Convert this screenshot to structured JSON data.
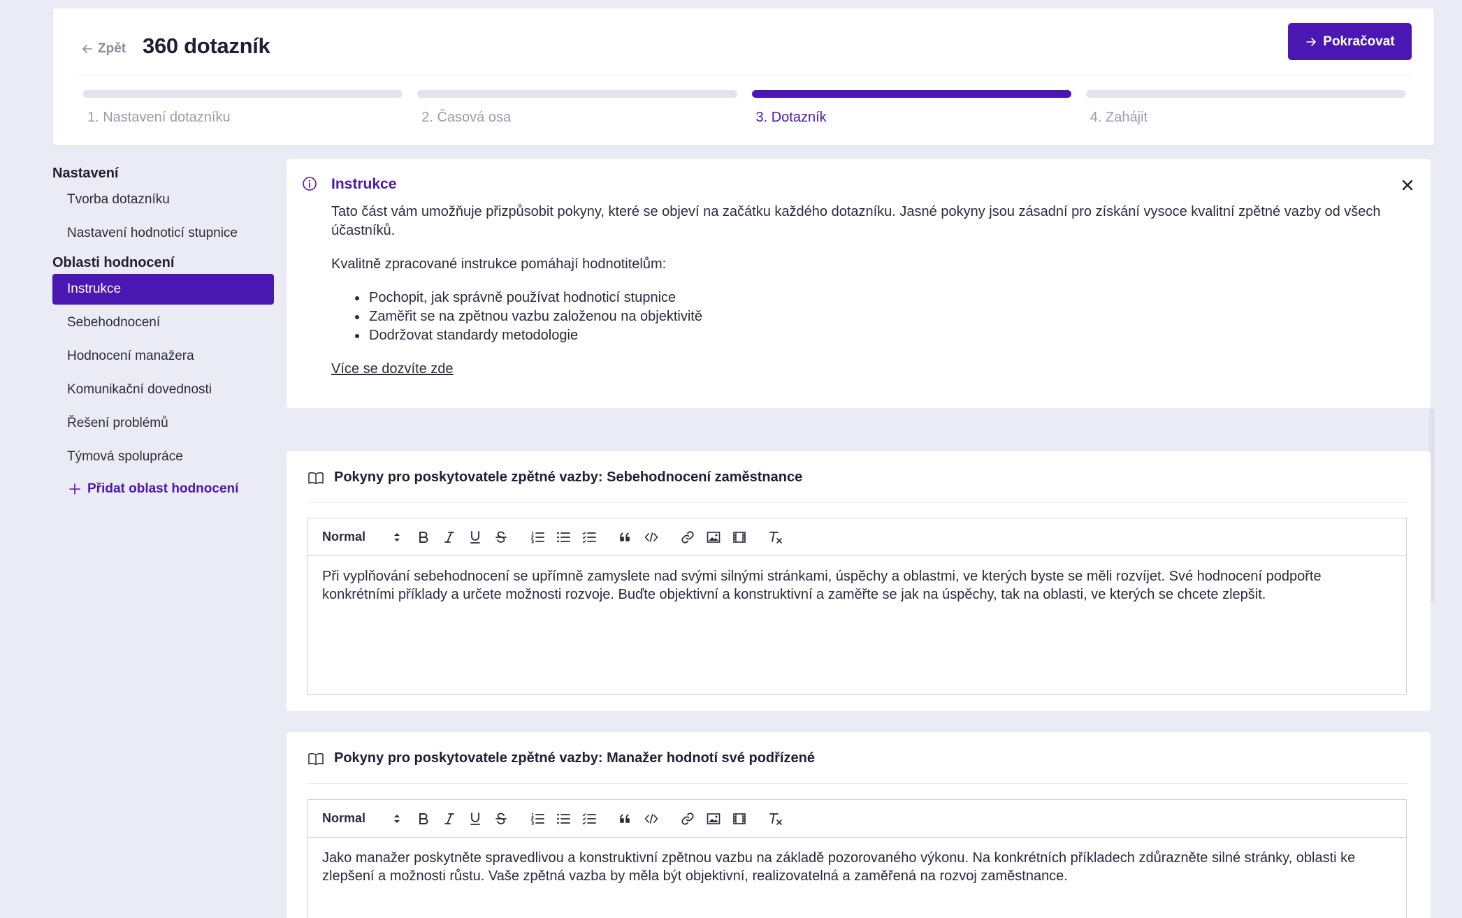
{
  "header": {
    "back_label": "Zpět",
    "title": "360 dotazník",
    "continue_label": "Pokračovat"
  },
  "stepper": [
    {
      "label": "1. Nastavení dotazníku",
      "active": false
    },
    {
      "label": "2. Časová osa",
      "active": false
    },
    {
      "label": "3. Dotazník",
      "active": true
    },
    {
      "label": "4. Zahájit",
      "active": false
    }
  ],
  "sidebar": {
    "settings_heading": "Nastavení",
    "settings_items": [
      "Tvorba dotazníku",
      "Nastavení hodnoticí stupnice"
    ],
    "areas_heading": "Oblasti hodnocení",
    "area_items": [
      "Instrukce",
      "Sebehodnocení",
      "Hodnocení manažera",
      "Komunikační dovednosti",
      "Řešení problémů",
      "Týmová spolupráce"
    ],
    "active_item": "Instrukce",
    "add_label": "Přidat oblast hodnocení"
  },
  "info": {
    "title": "Instrukce",
    "paragraph1": "Tato část vám umožňuje přizpůsobit pokyny, které se objeví na začátku každého dotazníku. Jasné pokyny jsou zásadní pro získání vysoce kvalitní zpětné vazby od všech účastníků.",
    "paragraph2": "Kvalitně zpracované instrukce pomáhají hodnotitelům:",
    "bullets": [
      "Pochopit, jak správně používat hodnoticí stupnice",
      "Zaměřit se na zpětnou vazbu založenou na objektivitě",
      "Dodržovat standardy metodologie"
    ],
    "link": "Více se dozvíte zde"
  },
  "sections": [
    {
      "title": "Pokyny pro poskytovatele zpětné vazby: Sebehodnocení zaměstnance",
      "format": "Normal",
      "content": "Při vyplňování sebehodnocení se upřímně zamyslete nad svými silnými stránkami, úspěchy a oblastmi, ve kterých byste se měli rozvíjet. Své hodnocení podpořte konkrétními příklady a určete možnosti rozvoje. Buďte objektivní a konstruktivní a zaměřte se jak na úspěchy, tak na oblasti, ve kterých se chcete zlepšit."
    },
    {
      "title": "Pokyny pro poskytovatele zpětné vazby: Manažer hodnotí své podřízené",
      "format": "Normal",
      "content": "Jako manažer poskytněte spravedlivou a konstruktivní zpětnou vazbu na základě pozorovaného výkonu. Na konkrétních příkladech zdůrazněte silné stránky, oblasti ke zlepšení a možnosti růstu. Vaše zpětná vazba by měla být objektivní, realizovatelná a zaměřená na rozvoj zaměstnance."
    }
  ],
  "toolbar_icons": [
    "bold-icon",
    "italic-icon",
    "underline-icon",
    "strike-icon",
    "ordered-list-icon",
    "bullet-list-icon",
    "check-list-icon",
    "quote-icon",
    "code-icon",
    "link-icon",
    "image-icon",
    "video-icon",
    "clear-format-icon"
  ],
  "colors": {
    "accent": "#4b17b3",
    "background": "#ebebf5",
    "muted_text": "#9b9bad"
  }
}
